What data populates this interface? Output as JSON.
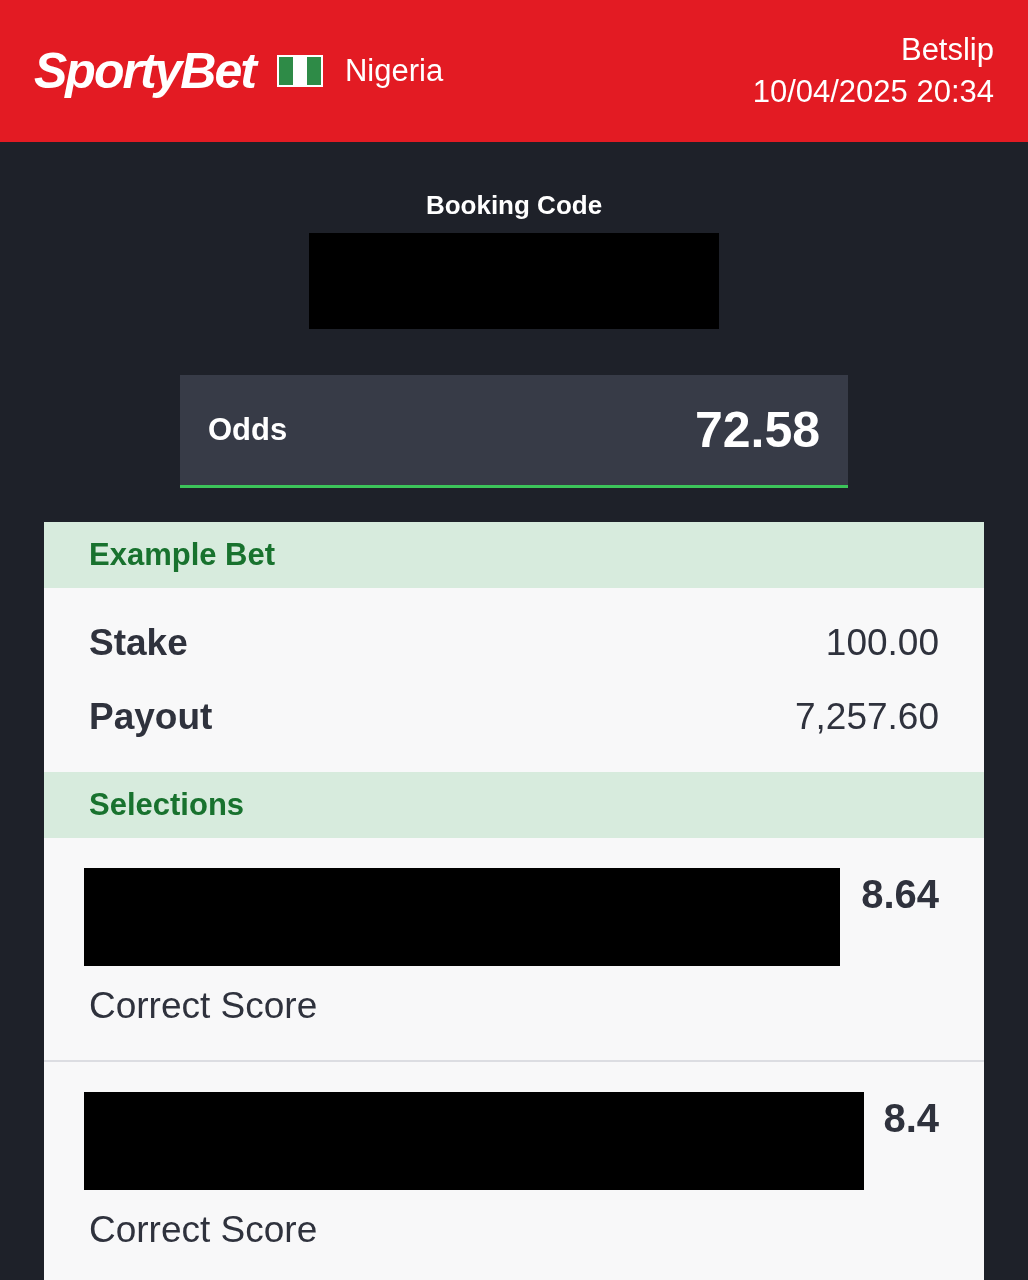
{
  "header": {
    "logo": "SportyBet",
    "country": "Nigeria",
    "title": "Betslip",
    "datetime": "10/04/2025 20:34"
  },
  "booking": {
    "label": "Booking Code",
    "redacted": true
  },
  "odds": {
    "label": "Odds",
    "value": "72.58"
  },
  "example_bet": {
    "title": "Example Bet",
    "rows": [
      {
        "label": "Stake",
        "value": "100.00"
      },
      {
        "label": "Payout",
        "value": "7,257.60"
      }
    ]
  },
  "selections": {
    "title": "Selections",
    "items": [
      {
        "odds": "8.64",
        "market": "Correct Score",
        "redacted": true
      },
      {
        "odds": "8.4",
        "market": "Correct Score",
        "redacted": true
      }
    ]
  }
}
